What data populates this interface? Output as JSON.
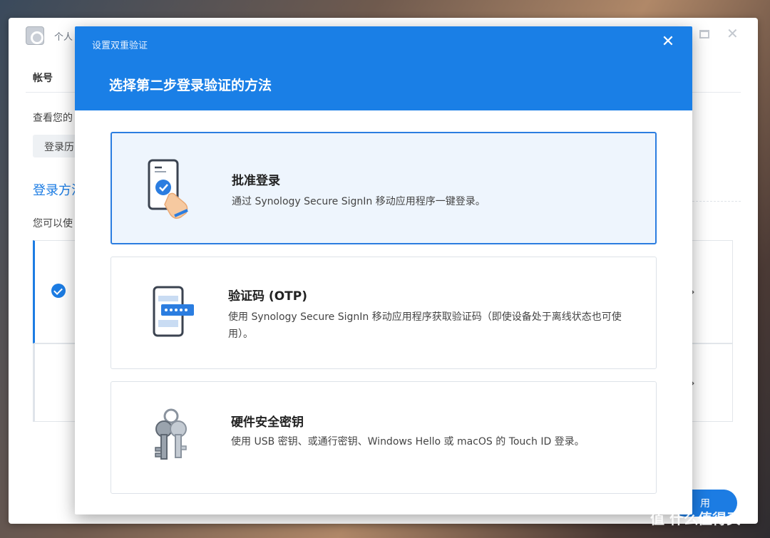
{
  "background": {
    "window_title": "个人",
    "tab": "帐号",
    "description": "查看您的",
    "history_button": "登录历",
    "section_title": "登录方法",
    "section_desc": "您可以使",
    "footer_button": "用"
  },
  "modal": {
    "window_title": "设置双重验证",
    "heading": "选择第二步登录验证的方法",
    "close_label": "✕",
    "options": [
      {
        "title": "批准登录",
        "description": "通过 Synology Secure SignIn 移动应用程序一键登录。",
        "icon": "phone-tap-icon",
        "selected": true
      },
      {
        "title": "验证码 (OTP)",
        "description": "使用 Synology Secure SignIn 移动应用程序获取验证码（即使设备处于离线状态也可使用）。",
        "icon": "phone-code-icon",
        "selected": false
      },
      {
        "title": "硬件安全密钥",
        "description": "使用 USB 密钥、或通行密钥、Windows Hello 或 macOS 的 Touch ID 登录。",
        "icon": "keys-icon",
        "selected": false
      }
    ]
  },
  "watermark": "值 什么值得买",
  "colors": {
    "accent": "#1a7fe6",
    "selected_bg": "#eef5fd"
  }
}
